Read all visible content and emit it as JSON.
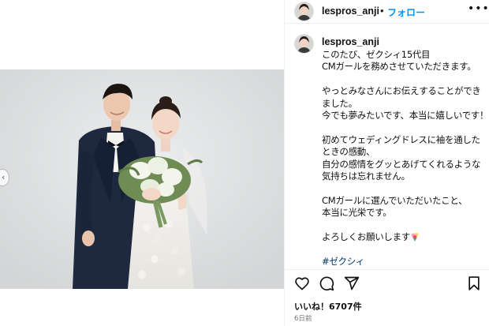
{
  "post": {
    "username": "lespros_anji",
    "dot": "•",
    "follow_label": "フォロー",
    "more_label": "•••"
  },
  "caption": {
    "username": "lespros_anji",
    "lines": [
      "このたび、ゼクシィ15代目",
      "CMガールを務めさせていただきます。",
      "",
      "やっとみなさんにお伝えすることができ",
      "ました。",
      "今でも夢みたいです、本当に嬉しいです！！",
      "",
      "初めてウェディングドレスに袖を通した",
      "ときの感動、",
      "自分の感情をグッとあげてくれるような",
      "気持ちは忘れません。",
      "",
      "CMガールに選んでいただいたこと、",
      "本当に光栄です。",
      "",
      "よろしくお願いします"
    ],
    "hashtag": "#ゼクシィ"
  },
  "actions": {
    "like_icon": "heart-icon",
    "comment_icon": "comment-icon",
    "share_icon": "send-icon",
    "save_icon": "bookmark-icon"
  },
  "stats": {
    "likes": "いいね！6707件",
    "time": "6日前"
  },
  "colors": {
    "accent": "#0095f6",
    "hashtag": "#00376b",
    "divider": "#efefef"
  }
}
